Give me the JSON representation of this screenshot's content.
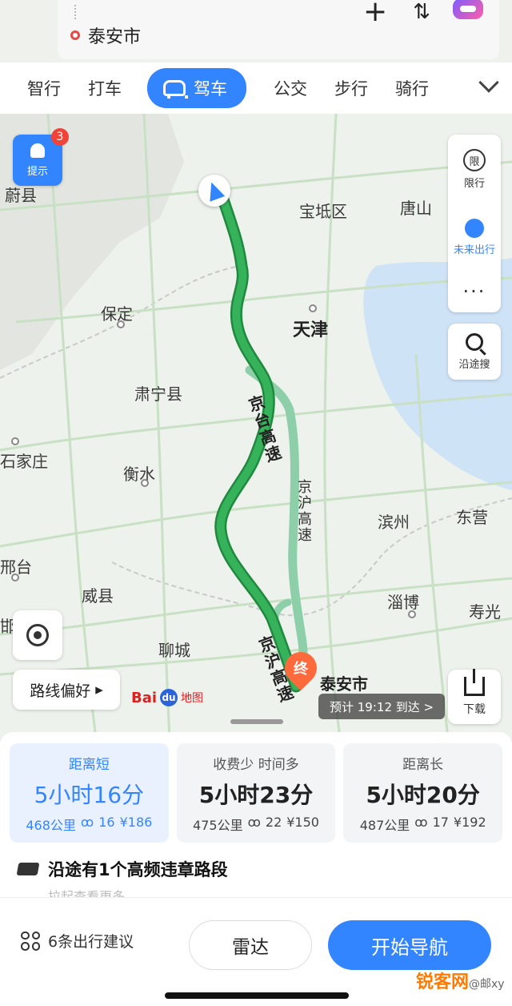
{
  "search": {
    "destination": "泰安市"
  },
  "modes": {
    "items": [
      "智行",
      "打车",
      "驾车",
      "公交",
      "步行",
      "骑行"
    ],
    "active_index": 2
  },
  "map": {
    "tip_label": "提示",
    "tip_badge": "3",
    "right_controls": {
      "limit_label": "限行",
      "limit_icon_text": "限",
      "future_label": "未来出行",
      "more_label": "···"
    },
    "search_along_label": "沿途搜",
    "route_pref_label": "路线偏好",
    "download_label": "下载",
    "baidu_logo": "Bai",
    "baidu_logo_paw": "du",
    "baidu_logo_sub": "地图",
    "eta_label": "预计 19:12 到达 >",
    "end_pin_label": "终",
    "end_city": "泰安市",
    "cities": {
      "weixian": "蔚县",
      "baodi": "宝坻区",
      "tangshan": "唐山",
      "baoding": "保定",
      "tianjin": "天津",
      "suning": "肃宁县",
      "shijiazhuang": "石家庄",
      "hengshui": "衡水",
      "binzhou": "滨州",
      "dongying": "东营",
      "xingtai": "邢台",
      "weixian2": "威县",
      "zibo": "淄博",
      "shouguang": "寿光",
      "handan": "邯",
      "liaocheng": "聊城"
    },
    "roads": {
      "jingtai": "京台高速",
      "jinghu": "京沪高速",
      "jinghu2": "京沪高速"
    },
    "colors": {
      "route_main": "#35b25a",
      "route_alt": "#8ccfa8",
      "accent": "#3385ff"
    }
  },
  "routes": [
    {
      "tag": "距离短",
      "time": "5小时16分",
      "distance": "468公里",
      "lights": "16",
      "toll": "¥186"
    },
    {
      "tag": "收费少 时间多",
      "time": "5小时23分",
      "distance": "475公里",
      "lights": "22",
      "toll": "¥150"
    },
    {
      "tag": "距离长",
      "time": "5小时20分",
      "distance": "487公里",
      "lights": "17",
      "toll": "¥192"
    }
  ],
  "warning": {
    "text": "沿途有1个高频违章路段",
    "hint": "拉起查看更多"
  },
  "actions": {
    "suggest_label": "6条出行建议",
    "radar_label": "雷达",
    "start_nav_label": "开始导航"
  },
  "watermark": {
    "brand": "锐客网",
    "sub": "@邮xy"
  }
}
